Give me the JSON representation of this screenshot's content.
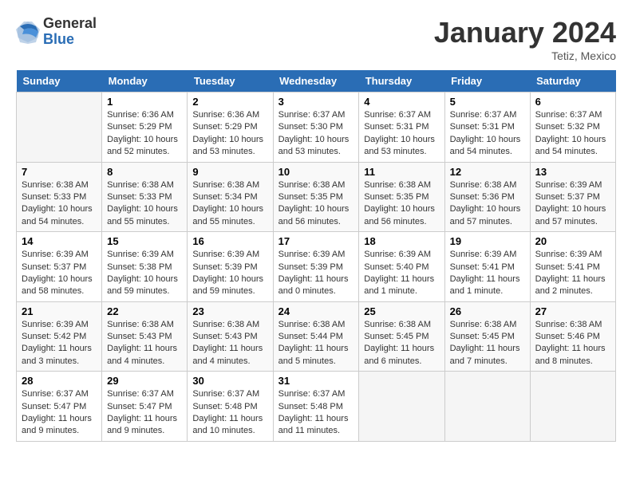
{
  "logo": {
    "general": "General",
    "blue": "Blue"
  },
  "title": "January 2024",
  "location": "Tetiz, Mexico",
  "days_of_week": [
    "Sunday",
    "Monday",
    "Tuesday",
    "Wednesday",
    "Thursday",
    "Friday",
    "Saturday"
  ],
  "weeks": [
    [
      {
        "day": "",
        "sunrise": "",
        "sunset": "",
        "daylight": ""
      },
      {
        "day": "1",
        "sunrise": "Sunrise: 6:36 AM",
        "sunset": "Sunset: 5:29 PM",
        "daylight": "Daylight: 10 hours and 52 minutes."
      },
      {
        "day": "2",
        "sunrise": "Sunrise: 6:36 AM",
        "sunset": "Sunset: 5:29 PM",
        "daylight": "Daylight: 10 hours and 53 minutes."
      },
      {
        "day": "3",
        "sunrise": "Sunrise: 6:37 AM",
        "sunset": "Sunset: 5:30 PM",
        "daylight": "Daylight: 10 hours and 53 minutes."
      },
      {
        "day": "4",
        "sunrise": "Sunrise: 6:37 AM",
        "sunset": "Sunset: 5:31 PM",
        "daylight": "Daylight: 10 hours and 53 minutes."
      },
      {
        "day": "5",
        "sunrise": "Sunrise: 6:37 AM",
        "sunset": "Sunset: 5:31 PM",
        "daylight": "Daylight: 10 hours and 54 minutes."
      },
      {
        "day": "6",
        "sunrise": "Sunrise: 6:37 AM",
        "sunset": "Sunset: 5:32 PM",
        "daylight": "Daylight: 10 hours and 54 minutes."
      }
    ],
    [
      {
        "day": "7",
        "sunrise": "Sunrise: 6:38 AM",
        "sunset": "Sunset: 5:33 PM",
        "daylight": "Daylight: 10 hours and 54 minutes."
      },
      {
        "day": "8",
        "sunrise": "Sunrise: 6:38 AM",
        "sunset": "Sunset: 5:33 PM",
        "daylight": "Daylight: 10 hours and 55 minutes."
      },
      {
        "day": "9",
        "sunrise": "Sunrise: 6:38 AM",
        "sunset": "Sunset: 5:34 PM",
        "daylight": "Daylight: 10 hours and 55 minutes."
      },
      {
        "day": "10",
        "sunrise": "Sunrise: 6:38 AM",
        "sunset": "Sunset: 5:35 PM",
        "daylight": "Daylight: 10 hours and 56 minutes."
      },
      {
        "day": "11",
        "sunrise": "Sunrise: 6:38 AM",
        "sunset": "Sunset: 5:35 PM",
        "daylight": "Daylight: 10 hours and 56 minutes."
      },
      {
        "day": "12",
        "sunrise": "Sunrise: 6:38 AM",
        "sunset": "Sunset: 5:36 PM",
        "daylight": "Daylight: 10 hours and 57 minutes."
      },
      {
        "day": "13",
        "sunrise": "Sunrise: 6:39 AM",
        "sunset": "Sunset: 5:37 PM",
        "daylight": "Daylight: 10 hours and 57 minutes."
      }
    ],
    [
      {
        "day": "14",
        "sunrise": "Sunrise: 6:39 AM",
        "sunset": "Sunset: 5:37 PM",
        "daylight": "Daylight: 10 hours and 58 minutes."
      },
      {
        "day": "15",
        "sunrise": "Sunrise: 6:39 AM",
        "sunset": "Sunset: 5:38 PM",
        "daylight": "Daylight: 10 hours and 59 minutes."
      },
      {
        "day": "16",
        "sunrise": "Sunrise: 6:39 AM",
        "sunset": "Sunset: 5:39 PM",
        "daylight": "Daylight: 10 hours and 59 minutes."
      },
      {
        "day": "17",
        "sunrise": "Sunrise: 6:39 AM",
        "sunset": "Sunset: 5:39 PM",
        "daylight": "Daylight: 11 hours and 0 minutes."
      },
      {
        "day": "18",
        "sunrise": "Sunrise: 6:39 AM",
        "sunset": "Sunset: 5:40 PM",
        "daylight": "Daylight: 11 hours and 1 minute."
      },
      {
        "day": "19",
        "sunrise": "Sunrise: 6:39 AM",
        "sunset": "Sunset: 5:41 PM",
        "daylight": "Daylight: 11 hours and 1 minute."
      },
      {
        "day": "20",
        "sunrise": "Sunrise: 6:39 AM",
        "sunset": "Sunset: 5:41 PM",
        "daylight": "Daylight: 11 hours and 2 minutes."
      }
    ],
    [
      {
        "day": "21",
        "sunrise": "Sunrise: 6:39 AM",
        "sunset": "Sunset: 5:42 PM",
        "daylight": "Daylight: 11 hours and 3 minutes."
      },
      {
        "day": "22",
        "sunrise": "Sunrise: 6:38 AM",
        "sunset": "Sunset: 5:43 PM",
        "daylight": "Daylight: 11 hours and 4 minutes."
      },
      {
        "day": "23",
        "sunrise": "Sunrise: 6:38 AM",
        "sunset": "Sunset: 5:43 PM",
        "daylight": "Daylight: 11 hours and 4 minutes."
      },
      {
        "day": "24",
        "sunrise": "Sunrise: 6:38 AM",
        "sunset": "Sunset: 5:44 PM",
        "daylight": "Daylight: 11 hours and 5 minutes."
      },
      {
        "day": "25",
        "sunrise": "Sunrise: 6:38 AM",
        "sunset": "Sunset: 5:45 PM",
        "daylight": "Daylight: 11 hours and 6 minutes."
      },
      {
        "day": "26",
        "sunrise": "Sunrise: 6:38 AM",
        "sunset": "Sunset: 5:45 PM",
        "daylight": "Daylight: 11 hours and 7 minutes."
      },
      {
        "day": "27",
        "sunrise": "Sunrise: 6:38 AM",
        "sunset": "Sunset: 5:46 PM",
        "daylight": "Daylight: 11 hours and 8 minutes."
      }
    ],
    [
      {
        "day": "28",
        "sunrise": "Sunrise: 6:37 AM",
        "sunset": "Sunset: 5:47 PM",
        "daylight": "Daylight: 11 hours and 9 minutes."
      },
      {
        "day": "29",
        "sunrise": "Sunrise: 6:37 AM",
        "sunset": "Sunset: 5:47 PM",
        "daylight": "Daylight: 11 hours and 9 minutes."
      },
      {
        "day": "30",
        "sunrise": "Sunrise: 6:37 AM",
        "sunset": "Sunset: 5:48 PM",
        "daylight": "Daylight: 11 hours and 10 minutes."
      },
      {
        "day": "31",
        "sunrise": "Sunrise: 6:37 AM",
        "sunset": "Sunset: 5:48 PM",
        "daylight": "Daylight: 11 hours and 11 minutes."
      },
      {
        "day": "",
        "sunrise": "",
        "sunset": "",
        "daylight": ""
      },
      {
        "day": "",
        "sunrise": "",
        "sunset": "",
        "daylight": ""
      },
      {
        "day": "",
        "sunrise": "",
        "sunset": "",
        "daylight": ""
      }
    ]
  ]
}
